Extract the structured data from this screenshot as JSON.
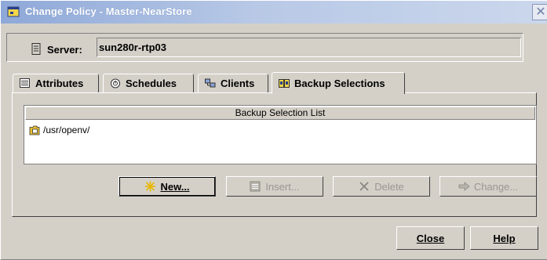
{
  "window": {
    "title": "Change Policy - Master-NearStore",
    "close_glyph": "✕"
  },
  "server": {
    "label": "Server:",
    "value": "sun280r-rtp03",
    "icon": "server-icon"
  },
  "tabs": [
    {
      "label": "Attributes",
      "icon": "attributes-icon",
      "active": false
    },
    {
      "label": "Schedules",
      "icon": "schedules-icon",
      "active": false
    },
    {
      "label": "Clients",
      "icon": "clients-icon",
      "active": false
    },
    {
      "label": "Backup Selections",
      "icon": "backup-selections-icon",
      "active": true
    }
  ],
  "backup_list": {
    "header": "Backup Selection List",
    "items": [
      {
        "path": "/usr/openv/",
        "icon": "folder-icon"
      }
    ]
  },
  "actions": {
    "new_label": "New...",
    "insert_label": "Insert...",
    "delete_label": "Delete",
    "change_label": "Change..."
  },
  "dialog_buttons": {
    "close_label": "Close",
    "help_label": "Help"
  },
  "colors": {
    "title_gradient_start": "#8ea8d8",
    "window_bg": "#d4d0c8",
    "list_bg": "#ffffff",
    "disabled_text": "#9a9790"
  }
}
